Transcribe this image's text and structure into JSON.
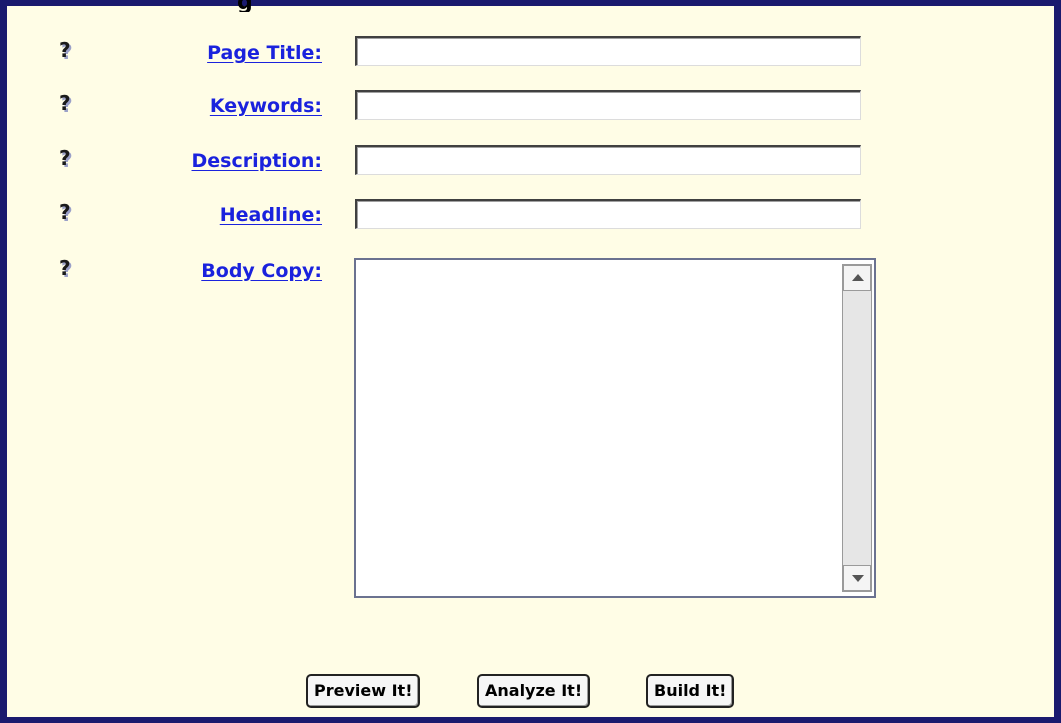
{
  "header": {
    "clipped_title_fragment": "g"
  },
  "help": {
    "glyph": "?",
    "icon": "help-icon"
  },
  "form": {
    "fields": [
      {
        "label": "Page Title:",
        "value": "",
        "placeholder": ""
      },
      {
        "label": "Keywords:",
        "value": "",
        "placeholder": ""
      },
      {
        "label": "Description:",
        "value": "",
        "placeholder": ""
      },
      {
        "label": "Headline:",
        "value": "",
        "placeholder": ""
      }
    ],
    "body_copy": {
      "label": "Body Copy:",
      "value": ""
    }
  },
  "actions": {
    "preview": "Preview It!",
    "analyze": "Analyze It!",
    "build": "Build It!"
  },
  "colors": {
    "frame_border": "#1a1a6e",
    "background": "#fffde6",
    "link": "#1a22dd"
  }
}
